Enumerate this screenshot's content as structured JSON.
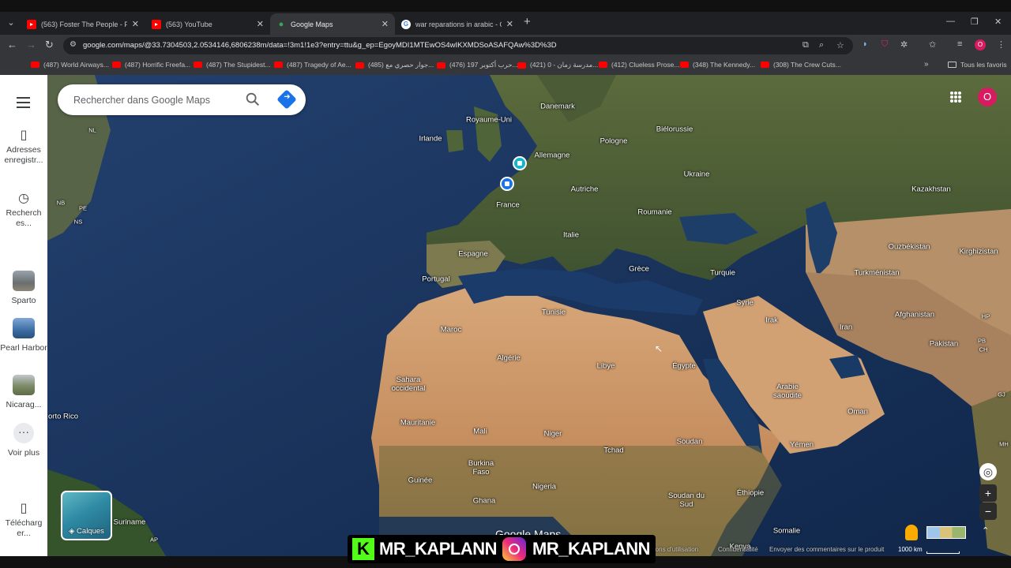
{
  "browser": {
    "tabs": [
      {
        "title": "(563) Foster The People - Pump",
        "type": "youtube"
      },
      {
        "title": "(563) YouTube",
        "type": "youtube"
      },
      {
        "title": "Google Maps",
        "type": "maps",
        "active": true
      },
      {
        "title": "war reparations in arabic - Goo",
        "type": "google"
      }
    ],
    "url": "google.com/maps/@33.7304503,2.0534146,6806238m/data=!3m1!1e3?entry=ttu&g_ep=EgoyMDI1MTEwOS4wIKXMDSoASAFQAw%3D%3D",
    "profile_initial": "O",
    "bookmarks": [
      "(487) World Airways...",
      "(487) Horrific Freefa...",
      "(487) The Stupidest...",
      "(487) Tragedy of Ae...",
      "(485) جوار حصري مع...",
      "(476) حرب أكتوبر 197...",
      "(421) مدرسة زمان - 0...",
      "(412) Clueless Prose...",
      "(348) The Kennedy...",
      "(308) The Crew Cuts..."
    ],
    "all_bookmarks": "Tous les favoris"
  },
  "sidebar": {
    "saved": "Adresses enregistr...",
    "recent": "Recherch es...",
    "places": [
      "Sparto",
      "Pearl Harbor",
      "Nicarag..."
    ],
    "more": "Voir plus",
    "download": "Télécharg er..."
  },
  "search": {
    "placeholder": "Rechercher dans Google Maps"
  },
  "account_initial": "O",
  "map": {
    "labels": [
      "Danemark",
      "Royaume-Uni",
      "Irlande",
      "Biélorussie",
      "Pologne",
      "Allemagne",
      "Ukraine",
      "Kazakhstan",
      "Autriche",
      "France",
      "Roumanie",
      "Italie",
      "Ouzbékistan",
      "Kirghizistan",
      "Espagne",
      "Portugal",
      "Grèce",
      "Turquie",
      "Turkménistan",
      "Syrie",
      "Tunisie",
      "Maroc",
      "Irak",
      "Iran",
      "Afghanistan",
      "Pakistan",
      "Algérie",
      "Libye",
      "Égypte",
      "Sahara occidental",
      "Arabie saoudite",
      "Oman",
      "Mauritanie",
      "Mali",
      "Niger",
      "Soudan",
      "Tchad",
      "Yémen",
      "Burkina Faso",
      "Guinée",
      "Nigeria",
      "Ghana",
      "Soudan du Sud",
      "Éthiopie",
      "Somalie",
      "Kenya",
      "orto Rico",
      "Suriname",
      "NL",
      "NB",
      "PE",
      "NS",
      "AP",
      "HP",
      "PB",
      "CH",
      "GJ",
      "MH"
    ],
    "layers_label": "Calques",
    "watermark": "Google Maps",
    "footer": [
      "nditions d'utilisation",
      "Confidentialité",
      "Envoyer des commentaires sur le produit"
    ],
    "scale": "1000 km"
  },
  "overlay": {
    "kick_name": "MR_KAPLANN",
    "instagram_name": "MR_KAPLANN"
  }
}
